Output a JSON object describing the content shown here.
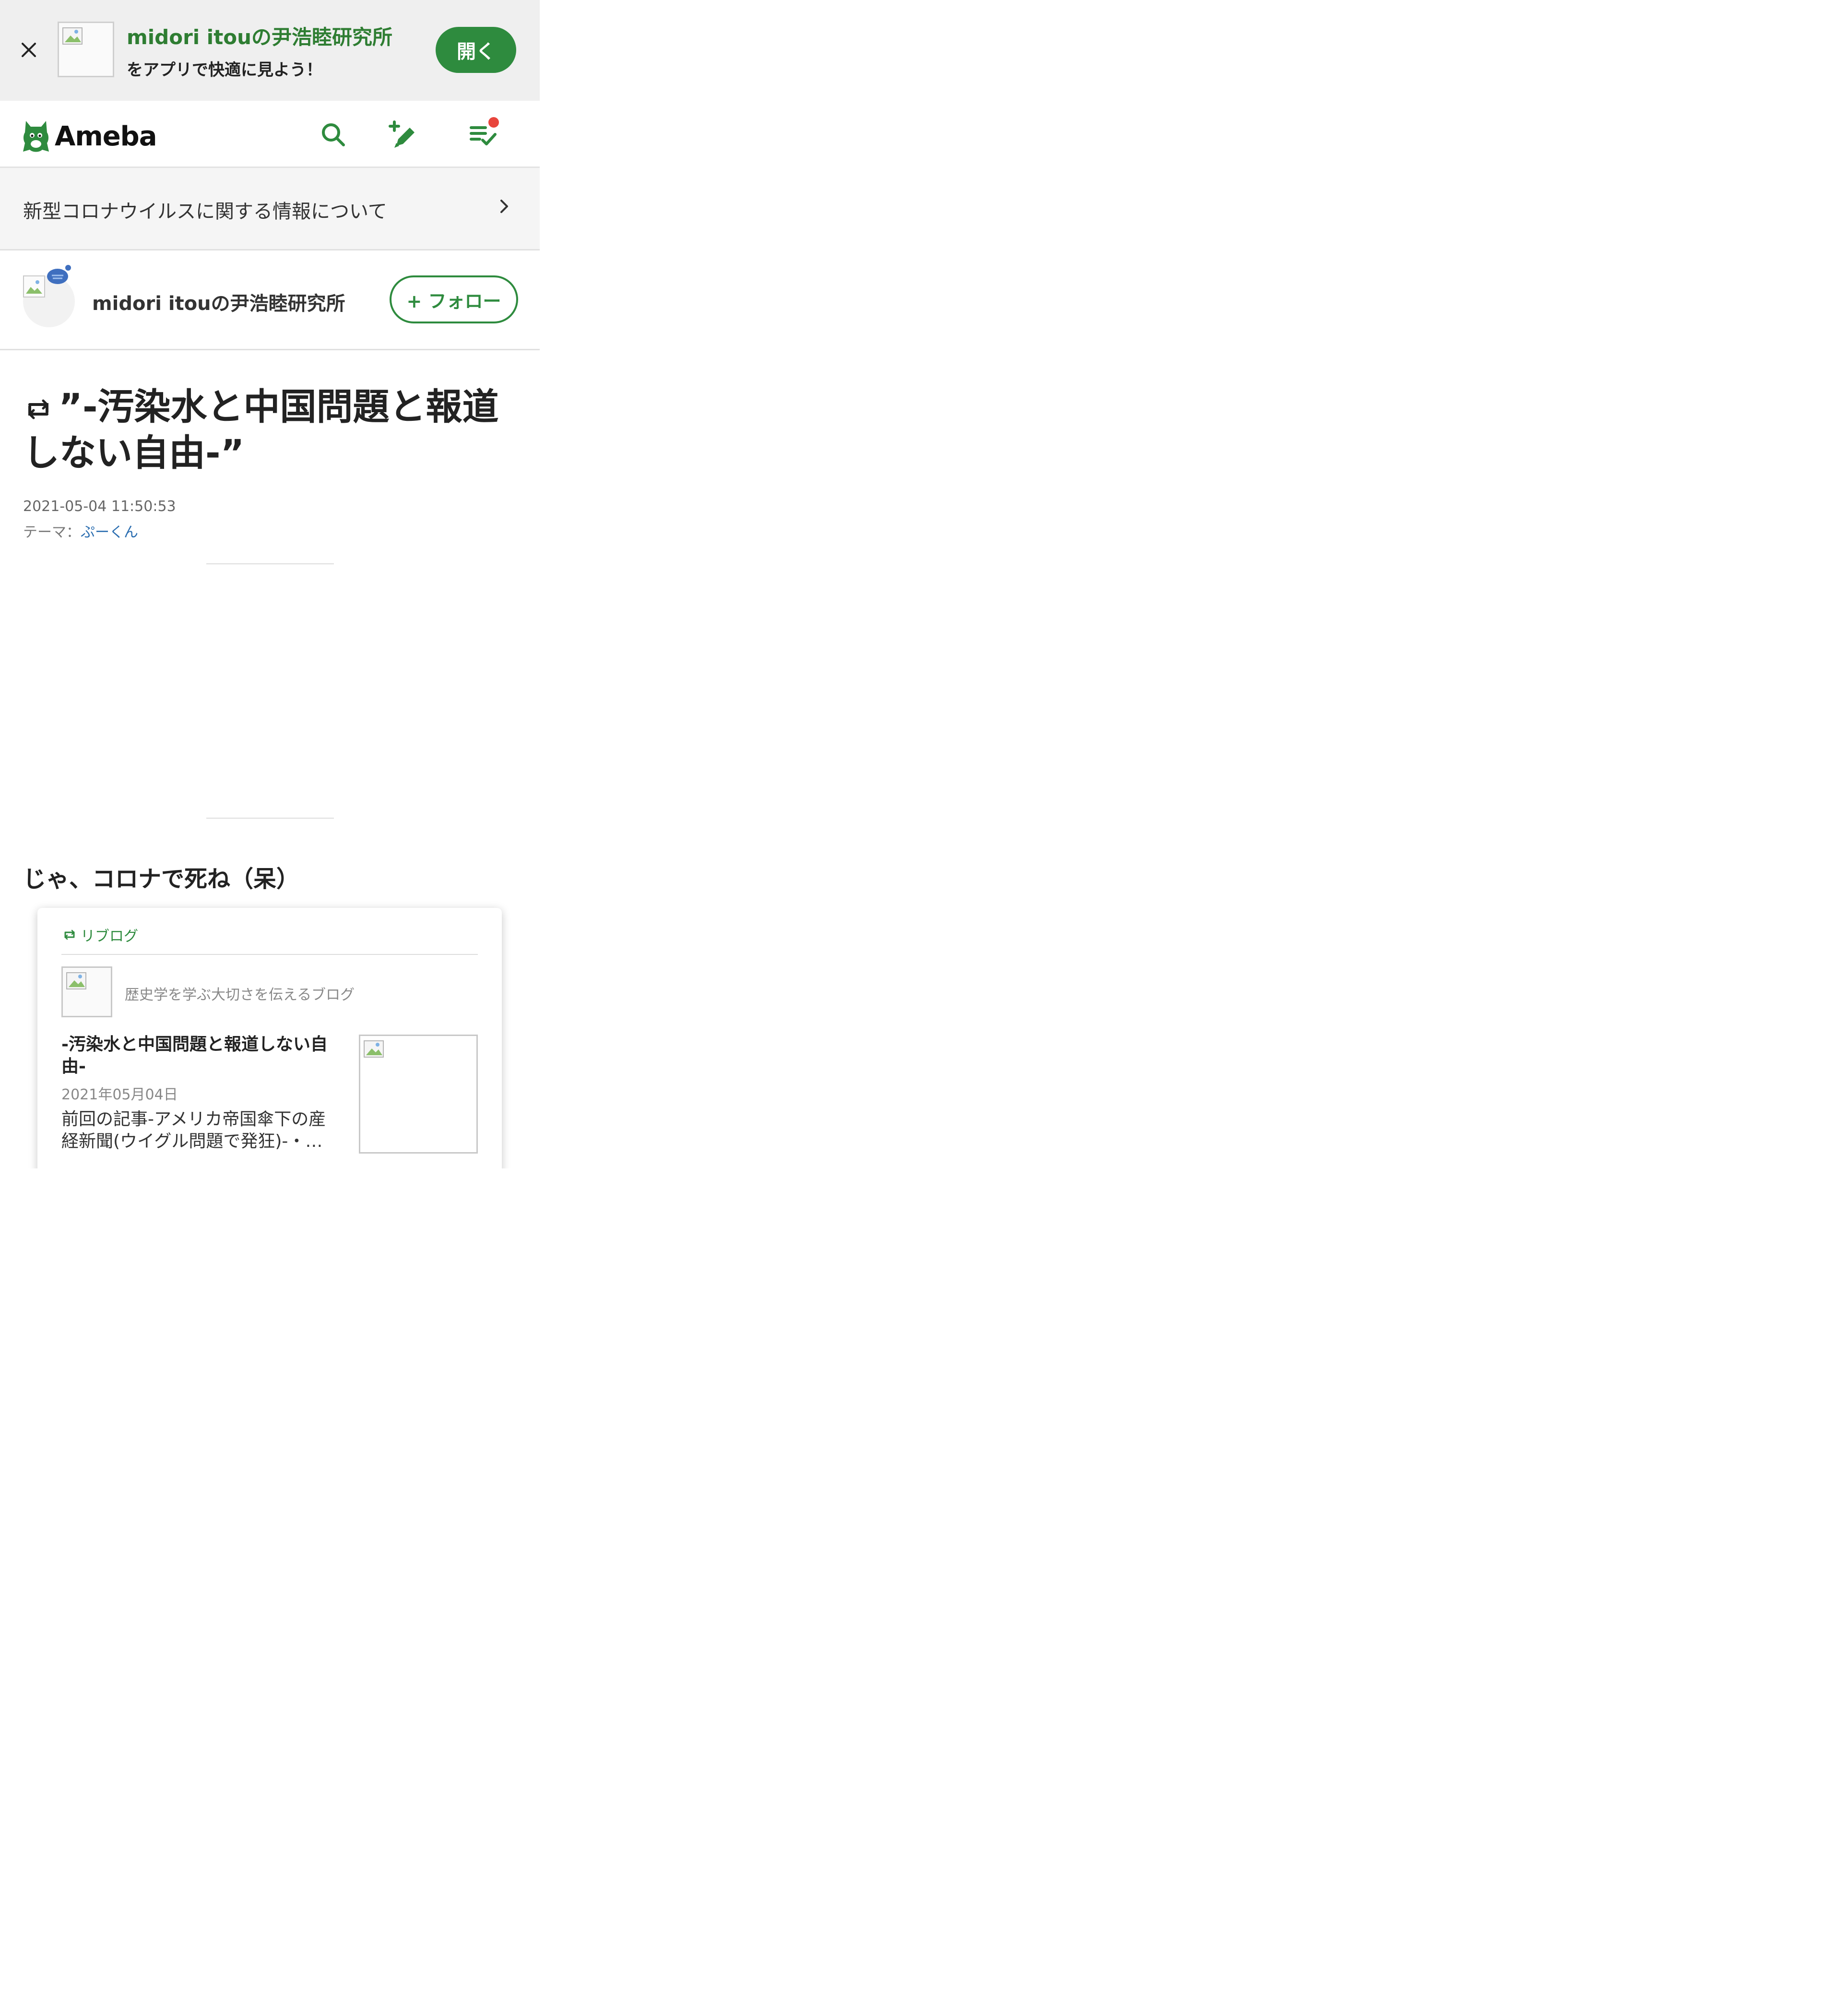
{
  "app_banner": {
    "close_icon": "close-icon",
    "title": "midori itouの尹浩睦研究所",
    "subtitle": "をアプリで快適に見よう！",
    "open_label": "開く",
    "accent_color": "#2e8b3e"
  },
  "header": {
    "logo_text": "Ameba",
    "icons": [
      "search-icon",
      "write-icon",
      "reading-list-icon"
    ],
    "notification_dot_color": "#e8453c"
  },
  "notice": {
    "text": "新型コロナウイルスに関する情報について",
    "chevron_icon": "chevron-right-icon"
  },
  "blog": {
    "name": "midori itouの尹浩睦研究所",
    "follow_label": "+ フォロー"
  },
  "article": {
    "title": "”-汚染水と中国問題と報道しない自由-”",
    "date": "2021-05-04 11:50:53",
    "theme_label": "テーマ：",
    "theme_value": "ぷーくん",
    "body_line": "じゃ、コロナで死ね（呆）"
  },
  "reblog_card": {
    "header_label": "リブログ",
    "blog_name": "歴史学を学ぶ大切さを伝えるブログ",
    "title": "-汚染水と中国問題と報道しない自由-",
    "date": "2021年05月04日",
    "excerpt": "前回の記事-アメリカ帝国傘下の産経新聞(ウイグル問題で発狂)-・…"
  }
}
